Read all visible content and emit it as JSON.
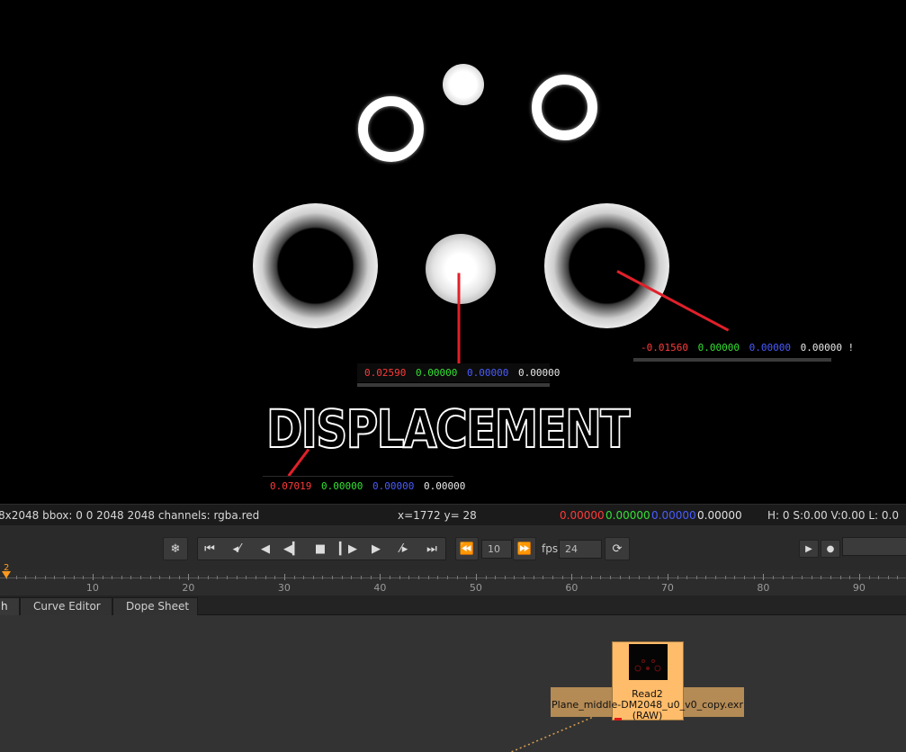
{
  "viewer": {
    "title_text": "DISPLACEMENT",
    "probes": [
      {
        "r": "0.02590",
        "g": "0.00000",
        "b": "0.00000",
        "a": "0.00000"
      },
      {
        "r": "-0.01560",
        "g": "0.00000",
        "b": "0.00000",
        "a": "0.00000 !"
      },
      {
        "r": "0.07019",
        "g": "0.00000",
        "b": "0.00000",
        "a": "0.00000"
      }
    ]
  },
  "infobar": {
    "format": "8x2048 bbox: 0 0 2048 2048 channels: rgba.red",
    "coords": "x=1772 y=  28",
    "r": "0.00000",
    "g": "0.00000",
    "b": "0.00000",
    "a": "0.00000",
    "hsv": "H:  0 S:0.00 V:0.00  L: 0.0"
  },
  "transport": {
    "frame_increment": "10",
    "fps_label": "fps",
    "fps_value": "24",
    "icons": [
      "snowflake-icon",
      "first-frame-icon",
      "prev-keyframe-icon",
      "play-backward-icon",
      "step-back-icon",
      "stop-icon",
      "step-forward-icon",
      "play-forward-icon",
      "next-keyframe-icon",
      "last-frame-icon",
      "rewind-icon",
      "fast-forward-icon",
      "loop-icon"
    ]
  },
  "timeline": {
    "current_frame": "2",
    "tick_labels": [
      "10",
      "20",
      "30",
      "40",
      "50",
      "60",
      "70",
      "80",
      "90"
    ]
  },
  "tabs": [
    {
      "label": "h"
    },
    {
      "label": "Curve Editor"
    },
    {
      "label": "Dope Sheet"
    }
  ],
  "node": {
    "name": "Read2",
    "file": "Plane_middle-DM2048_u0_v0_copy.exr",
    "colorspace": "(RAW)",
    "color_body": "#ffbc6a",
    "color_label": "#b48a55"
  }
}
